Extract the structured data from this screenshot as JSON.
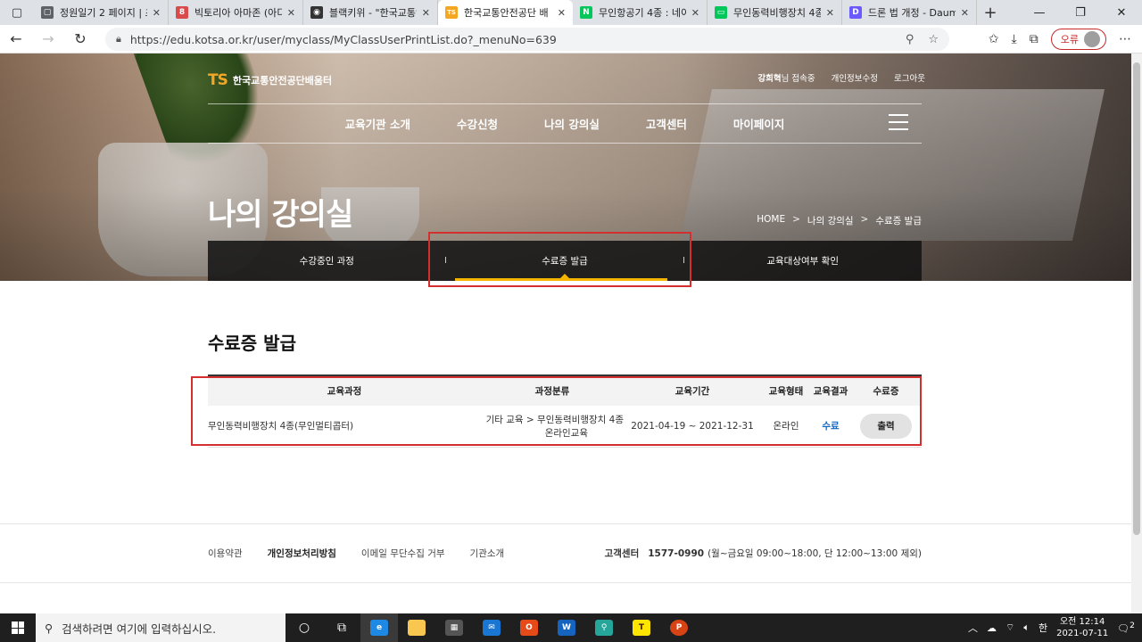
{
  "browser": {
    "tabs": [
      {
        "title": "정원일기 2 페이지 | 초",
        "color": "#5f6368",
        "glyph": "▢"
      },
      {
        "title": "빅토리아 아마존 (아디",
        "color": "#d94b4b",
        "glyph": "8"
      },
      {
        "title": "블랙키위 - \"한국교통안",
        "color": "#333333",
        "glyph": "◉"
      },
      {
        "title": "한국교통안전공단 배",
        "color": "#f5a623",
        "glyph": "TS"
      },
      {
        "title": "무인항공기 4종 : 네이",
        "color": "#03c75a",
        "glyph": "N"
      },
      {
        "title": "무인동력비행장치 4종",
        "color": "#03c75a",
        "glyph": "▭"
      },
      {
        "title": "드론 법 개정 - Daum",
        "color": "#6b5bff",
        "glyph": "D"
      }
    ],
    "url": "https://edu.kotsa.or.kr/user/myclass/MyClassUserPrintList.do?_menuNo=639",
    "error_label": "오류"
  },
  "site": {
    "logo_mark": "TS",
    "logo_text": "한국교통안전공단배움터",
    "user_name": "강희혁",
    "user_suffix": "님 접속중",
    "privacy_edit": "개인정보수정",
    "logout": "로그아웃",
    "gnb": [
      "교육기관 소개",
      "수강신청",
      "나의 강의실",
      "고객센터",
      "마이페이지"
    ],
    "hero_title": "나의 강의실",
    "breadcrumb": [
      "HOME",
      "나의 강의실",
      "수료증 발급"
    ],
    "subtabs": [
      "수강중인 과정",
      "수료증 발급",
      "교육대상여부 확인"
    ]
  },
  "content": {
    "heading": "수료증 발급",
    "columns": [
      "교육과정",
      "과정분류",
      "교육기간",
      "교육형태",
      "교육결과",
      "수료증"
    ],
    "rows": [
      {
        "course": "무인동력비행장치 4종(무인멀티콥터)",
        "category_line1": "기타 교육 > 무인동력비행장치 4종",
        "category_line2": "온라인교육",
        "period": "2021-04-19 ~ 2021-12-31",
        "type": "온라인",
        "result": "수료",
        "action": "출력"
      }
    ]
  },
  "footer": {
    "links": [
      "이용약관",
      "개인정보처리방침",
      "이메일 무단수집 거부",
      "기관소개"
    ],
    "cs_label": "고객센터",
    "cs_phone": "1577-0990",
    "cs_hours": "(월~금요일 09:00~18:00, 단 12:00~13:00 제외)"
  },
  "taskbar": {
    "search_placeholder": "검색하려면 여기에 입력하십시오.",
    "time_ampm": "오전 12:14",
    "date": "2021-07-11",
    "ime": "한",
    "notif_count": "2"
  },
  "colors": {
    "accent": "#f4b400",
    "highlight_box": "#d32f2f",
    "result_blue": "#1565c0"
  }
}
